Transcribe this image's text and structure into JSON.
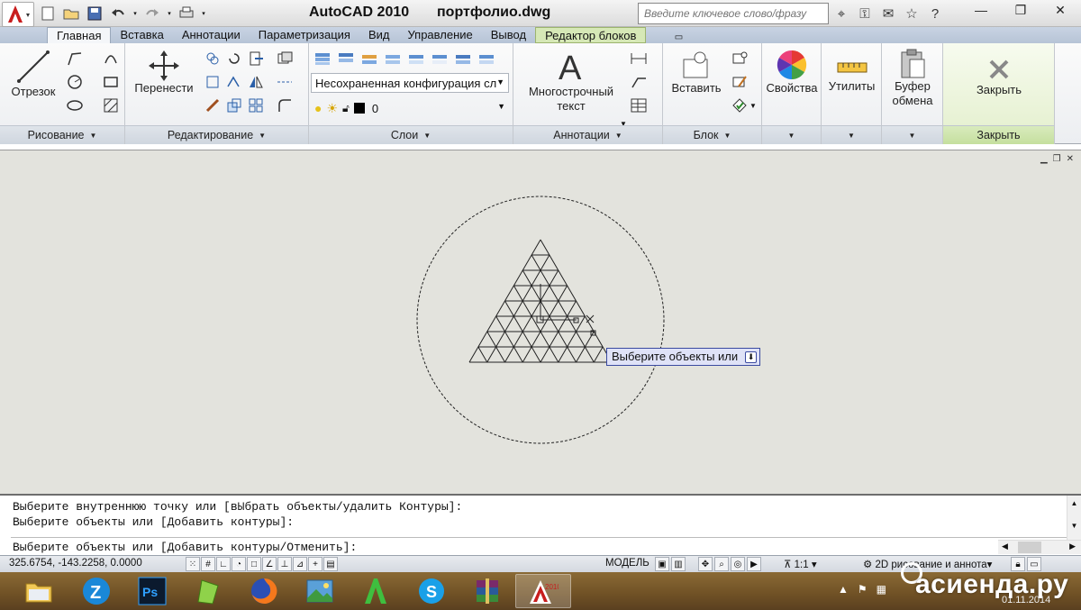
{
  "window": {
    "app_title": "AutoCAD 2010",
    "file_title": "портфолио.dwg",
    "search_placeholder": "Введите ключевое слово/фразу"
  },
  "tabs": [
    "Главная",
    "Вставка",
    "Аннотации",
    "Параметризация",
    "Вид",
    "Управление",
    "Вывод",
    "Редактор блоков"
  ],
  "active_tab": "Главная",
  "ribbon": {
    "draw": {
      "line_label": "Отрезок",
      "footer": "Рисование"
    },
    "modify": {
      "move_label": "Перенести",
      "footer": "Редактирование"
    },
    "layers": {
      "layer_state": "Несохраненная конфигурация сл",
      "current_layer": "0",
      "footer": "Слои"
    },
    "annotation": {
      "mtext_label_1": "Многострочный",
      "mtext_label_2": "текст",
      "footer": "Аннотации"
    },
    "block": {
      "insert_label": "Вставить",
      "footer": "Блок"
    },
    "properties": {
      "label": "Свойства"
    },
    "utilities": {
      "label": "Утилиты"
    },
    "clipboard": {
      "label_1": "Буфер",
      "label_2": "обмена"
    },
    "close": {
      "label": "Закрыть",
      "footer": "Закрыть"
    }
  },
  "canvas": {
    "tooltip": "Выберите объекты или"
  },
  "command_line": {
    "history": [
      "Выберите внутреннюю точку или [вЫбрать объекты/удалить Контуры]:",
      "Выберите объекты или [Добавить контуры]:"
    ],
    "prompt": "Выберите объекты или [Добавить контуры/Отменить]:"
  },
  "status_bar": {
    "coordinates": "325.6754,  -143.2258, 0.0000",
    "space": "МОДЕЛЬ",
    "annotation_scale": "1:1",
    "workspace": "2D рисование и аннота"
  },
  "taskbar": {
    "apps": [
      "explorer",
      "zoom",
      "photoshop",
      "notepad",
      "firefox",
      "photos",
      "autocad-a",
      "skype",
      "winrar",
      "autocad-2010"
    ],
    "active": "autocad-2010",
    "date": "01.11.2014"
  },
  "watermark": "асиенда.ру",
  "colors": {
    "ribbon_tab_bar": "#b7c4d6",
    "canvas_bg": "#e3e3dd",
    "taskbar": "#6f5025",
    "tooltip_bg": "#dfe2f7",
    "special_tab": "#d6e8b6"
  }
}
